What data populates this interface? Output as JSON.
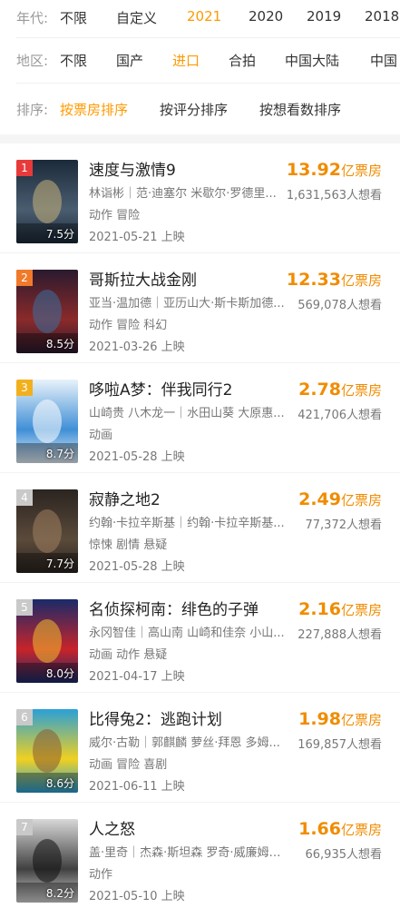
{
  "filters": {
    "year": {
      "label": "年代:",
      "options": [
        "不限",
        "自定义",
        "2021",
        "2020",
        "2019",
        "2018"
      ],
      "active": "2021"
    },
    "region": {
      "label": "地区:",
      "options": [
        "不限",
        "国产",
        "进口",
        "合拍",
        "中国大陆",
        "中国"
      ],
      "active": "进口"
    },
    "sort": {
      "label": "排序:",
      "options": [
        "按票房排序",
        "按评分排序",
        "按想看数排序"
      ],
      "active": "按票房排序"
    }
  },
  "movies": [
    {
      "rank": "1",
      "title": "速度与激情9",
      "cast": "林诣彬｜范·迪塞尔 米歇尔·罗德里...",
      "genre": "动作 冒险",
      "date": "2021-05-21 上映",
      "score": "7.5分",
      "box_num": "13.92",
      "box_unit": "亿票房",
      "want": "1,631,563人想看",
      "rank_color": "#e83a3a",
      "poster_colors": [
        "#1b2a3a",
        "#4a5d70",
        "#c9b27a"
      ]
    },
    {
      "rank": "2",
      "title": "哥斯拉大战金刚",
      "cast": "亚当·温加德｜亚历山大·斯卡斯加德...",
      "genre": "动作 冒险 科幻",
      "date": "2021-03-26 上映",
      "score": "8.5分",
      "box_num": "12.33",
      "box_unit": "亿票房",
      "want": "569,078人想看",
      "rank_color": "#f07a2a",
      "poster_colors": [
        "#2a1a2e",
        "#8b2a2a",
        "#3a6fa0"
      ]
    },
    {
      "rank": "3",
      "title": "哆啦A梦：伴我同行2",
      "cast": "山崎贵 八木龙一｜水田山葵 大原惠...",
      "genre": "动画",
      "date": "2021-05-28 上映",
      "score": "8.7分",
      "box_num": "2.78",
      "box_unit": "亿票房",
      "want": "421,706人想看",
      "rank_color": "#f2b01e",
      "poster_colors": [
        "#e8f2fa",
        "#3f8fd6",
        "#ffffff"
      ]
    },
    {
      "rank": "4",
      "title": "寂静之地2",
      "cast": "约翰·卡拉辛斯基｜约翰·卡拉辛斯基...",
      "genre": "惊悚 剧情 悬疑",
      "date": "2021-05-28 上映",
      "score": "7.7分",
      "box_num": "2.49",
      "box_unit": "亿票房",
      "want": "77,372人想看",
      "rank_color": "#c9c9c9",
      "poster_colors": [
        "#2b2420",
        "#5a4a3a",
        "#a08060"
      ]
    },
    {
      "rank": "5",
      "title": "名侦探柯南：绯色的子弹",
      "cast": "永冈智佳｜高山南 山崎和佳奈 小山...",
      "genre": "动画 动作 悬疑",
      "date": "2021-04-17 上映",
      "score": "8.0分",
      "box_num": "2.16",
      "box_unit": "亿票房",
      "want": "227,888人想看",
      "rank_color": "#c9c9c9",
      "poster_colors": [
        "#1a2a6a",
        "#c8242a",
        "#f0c030"
      ]
    },
    {
      "rank": "6",
      "title": "比得兔2：逃跑计划",
      "cast": "威尔·古勒｜郭麒麟 萝丝·拜恩 多姆...",
      "genre": "动画 冒险 喜剧",
      "date": "2021-06-11 上映",
      "score": "8.6分",
      "box_num": "1.98",
      "box_unit": "亿票房",
      "want": "169,857人想看",
      "rank_color": "#c9c9c9",
      "poster_colors": [
        "#2aa0d8",
        "#f0d020",
        "#8a5a30"
      ]
    },
    {
      "rank": "7",
      "title": "人之怒",
      "cast": "盖·里奇｜杰森·斯坦森 罗奇·威廉姆斯...",
      "genre": "动作",
      "date": "2021-05-10 上映",
      "score": "8.2分",
      "box_num": "1.66",
      "box_unit": "亿票房",
      "want": "66,935人想看",
      "rank_color": "#c9c9c9",
      "poster_colors": [
        "#d8d8d8",
        "#404040",
        "#101010"
      ]
    }
  ]
}
